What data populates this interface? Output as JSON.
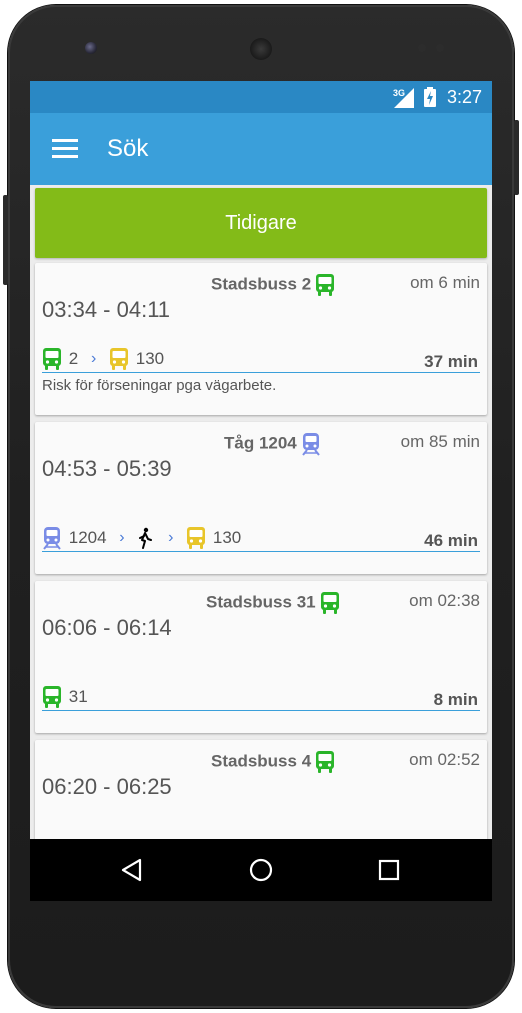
{
  "status_bar": {
    "network": "3G",
    "time": "3:27"
  },
  "app_bar": {
    "title": "Sök",
    "menu_icon": "menu-icon"
  },
  "earlier_button": {
    "label": "Tidigare"
  },
  "trips": [
    {
      "vehicle": "Stadsbuss 2",
      "vehicle_icon": "bus-icon",
      "departs": "om 6 min",
      "times": "03:34 - 04:11",
      "legs": [
        {
          "type": "bus",
          "color": "#2ab52a",
          "label": "2"
        },
        {
          "type": "bus",
          "color": "#e8c52a",
          "label": "130"
        }
      ],
      "duration": "37 min",
      "notice": "Risk för förseningar pga vägarbete."
    },
    {
      "vehicle": "Tåg 1204",
      "vehicle_icon": "train-icon",
      "departs": "om 85 min",
      "times": "04:53 - 05:39",
      "legs": [
        {
          "type": "train",
          "color": "#7a8ce6",
          "label": "1204"
        },
        {
          "type": "walk",
          "color": "#000000",
          "label": ""
        },
        {
          "type": "bus",
          "color": "#e8c52a",
          "label": "130"
        }
      ],
      "duration": "46 min"
    },
    {
      "vehicle": "Stadsbuss 31",
      "vehicle_icon": "bus-icon",
      "departs": "om 02:38",
      "times": "06:06 - 06:14",
      "legs": [
        {
          "type": "bus",
          "color": "#2ab52a",
          "label": "31"
        }
      ],
      "duration": "8 min"
    },
    {
      "vehicle": "Stadsbuss 4",
      "vehicle_icon": "bus-icon",
      "departs": "om 02:52",
      "times": "06:20 - 06:25"
    }
  ],
  "nav_bar": {
    "back": "back-icon",
    "home": "home-icon",
    "recents": "recents-icon"
  },
  "colors": {
    "status_bar": "#2a88c4",
    "app_bar": "#3a9fda",
    "earlier_button": "#83bb18",
    "bus_green": "#2ab52a",
    "bus_yellow": "#e8c52a",
    "train_blue": "#7a8ce6"
  }
}
